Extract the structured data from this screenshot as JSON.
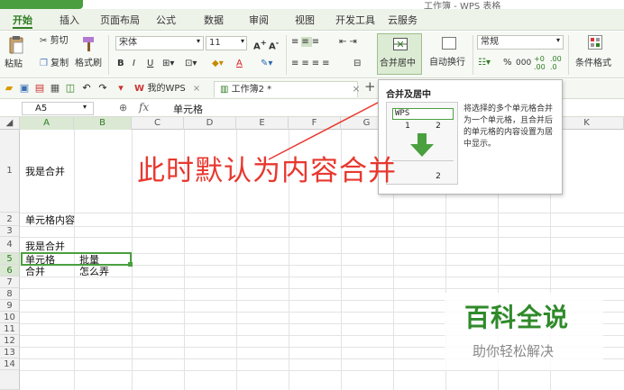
{
  "window": {
    "title": "WPS 表格",
    "right_title": "工作簿 - WPS 表格"
  },
  "menu": {
    "tabs": [
      "开始",
      "插入",
      "页面布局",
      "公式",
      "数据",
      "审阅",
      "视图",
      "开发工具",
      "云服务"
    ]
  },
  "ribbon": {
    "paste": "粘贴",
    "cut": "剪切",
    "copy": "复制",
    "format_painter": "格式刷",
    "font_name": "宋体",
    "font_size": "11",
    "bold": "B",
    "italic": "I",
    "underline": "U",
    "merge_center": "合并居中",
    "wrap_text": "自动换行",
    "number_format": "常规",
    "percent": "%",
    "comma": "000",
    "cond_format": "条件格式",
    "font_color_letter": "A"
  },
  "toolbar": {
    "tab_mywps": "我的WPS",
    "tab_book": "工作簿2 *",
    "add_tab": "+"
  },
  "formula_bar": {
    "cell_ref": "A5",
    "fx": "fx",
    "value": "单元格"
  },
  "columns": [
    "A",
    "B",
    "C",
    "D",
    "E",
    "F",
    "G",
    "H",
    "I",
    "J",
    "K"
  ],
  "rows": [
    "1",
    "2",
    "3",
    "4",
    "5",
    "6",
    "7",
    "8",
    "9",
    "10",
    "11",
    "12",
    "13",
    "14"
  ],
  "cells": {
    "r1a": "我是合并",
    "r2a": "单元格内容",
    "r4a": "我是合并",
    "r5a": "单元格",
    "r5b": "批量",
    "r6a": "合并",
    "r6b": "怎么弄"
  },
  "tooltip": {
    "title": "合并及居中",
    "demo_top": "WPS",
    "demo_1": "1",
    "demo_2": "2",
    "demo_bottom": "2",
    "description": "将选择的多个单元格合并为一个单元格，且合并后的单元格的内容设置为居中显示。"
  },
  "annotation": {
    "text": "此时默认为内容合并",
    "color": "#e8382f"
  },
  "watermark": {
    "title": "百科全说",
    "subtitle": "助你轻松解决"
  },
  "colors": {
    "accent": "#2f7d22",
    "selection": "#4aa03f"
  }
}
